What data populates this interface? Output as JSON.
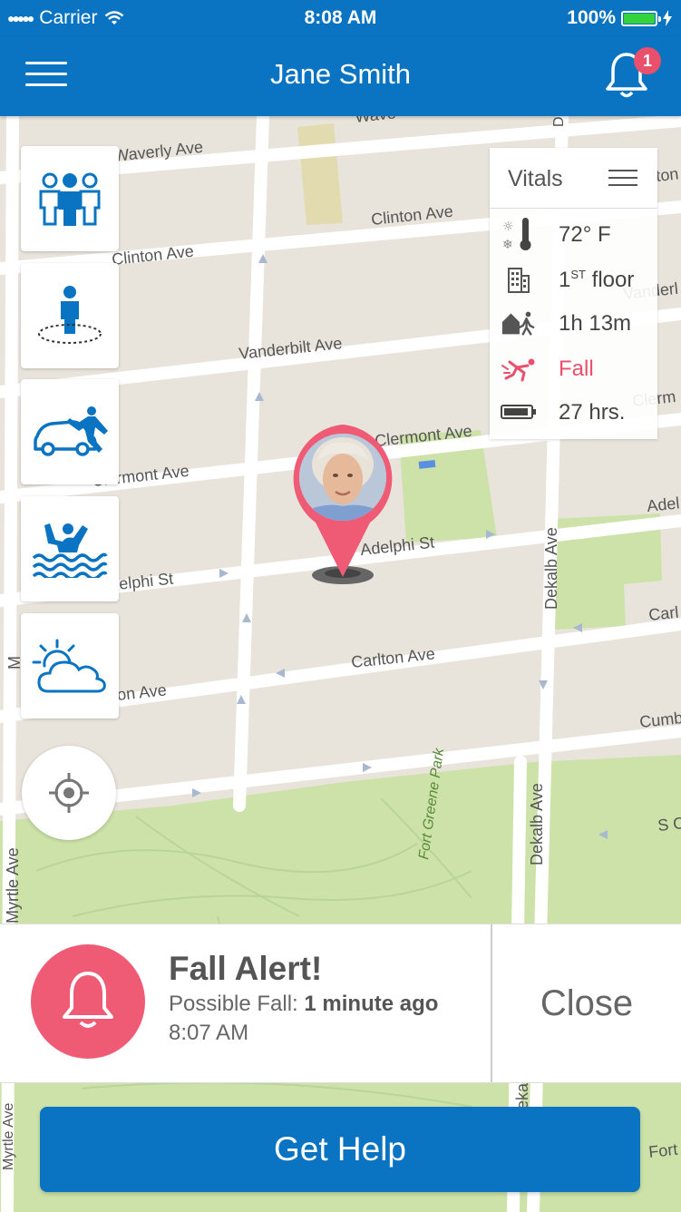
{
  "status_bar": {
    "carrier": "Carrier",
    "time": "8:08 AM",
    "battery": "100%"
  },
  "nav": {
    "title": "Jane Smith",
    "notification_count": "1"
  },
  "map": {
    "streets": [
      {
        "id": "waverly",
        "label": "Waverly Ave"
      },
      {
        "id": "waverly2",
        "label": "Wave"
      },
      {
        "id": "clinton",
        "label": "Clinton Ave"
      },
      {
        "id": "clinton2",
        "label": "Clinton Ave"
      },
      {
        "id": "vanderbilt",
        "label": "Vanderbilt Ave"
      },
      {
        "id": "vanderbilt2",
        "label": "Vanderl"
      },
      {
        "id": "clermont",
        "label": "Clermont Ave"
      },
      {
        "id": "clermont2",
        "label": "Clermont Ave"
      },
      {
        "id": "clermont3",
        "label": "Clerm"
      },
      {
        "id": "adelphi",
        "label": "Adelphi St"
      },
      {
        "id": "adelphi2",
        "label": "Adelphi St"
      },
      {
        "id": "adelphi3",
        "label": "Adel"
      },
      {
        "id": "carlton",
        "label": "Carlton Ave"
      },
      {
        "id": "carlton2",
        "label": "Carlton Ave"
      },
      {
        "id": "carlton3",
        "label": "Carl"
      },
      {
        "id": "cumb",
        "label": "Cumb"
      },
      {
        "id": "soc",
        "label": "S O"
      },
      {
        "id": "fort",
        "label": "Fort"
      },
      {
        "id": "dekalb",
        "label": "Dekalb Ave"
      },
      {
        "id": "dekalb2",
        "label": "Dekalb Ave"
      },
      {
        "id": "dekalb3",
        "label": "Dekalb Ave"
      },
      {
        "id": "dekalb4",
        "label": "Deka"
      },
      {
        "id": "myrtle",
        "label": "Myrtle Ave"
      },
      {
        "id": "myrtle2",
        "label": "Myrtle Ave"
      },
      {
        "id": "myrtle3",
        "label": "M"
      },
      {
        "id": "fton",
        "label": "ton"
      },
      {
        "id": "park",
        "label": "Fort Greene Park"
      }
    ]
  },
  "tools": [
    {
      "name": "group-tool-button",
      "icon": "group-icon"
    },
    {
      "name": "geofence-tool-button",
      "icon": "person-geofence-icon"
    },
    {
      "name": "car-accident-tool-button",
      "icon": "car-accident-icon"
    },
    {
      "name": "drowning-tool-button",
      "icon": "drowning-icon"
    },
    {
      "name": "weather-tool-button",
      "icon": "weather-icon"
    }
  ],
  "vitals": {
    "title": "Vitals",
    "temperature": "72° F",
    "floor_num": "1",
    "floor_suffix": "ST",
    "floor_word": "floor",
    "away_time": "1h 13m",
    "status": "Fall",
    "battery": "27 hrs.",
    "colors": {
      "alert": "#e8506b"
    }
  },
  "alert": {
    "title": "Fall Alert!",
    "desc_prefix": "Possible Fall:",
    "desc_bold": "1 minute ago",
    "time": "8:07 AM",
    "close_label": "Close"
  },
  "get_help_label": "Get Help",
  "colors": {
    "brand": "#0a74c2",
    "alert": "#ef5a74",
    "park": "#cde2a8",
    "map_bg": "#e8e4dc"
  }
}
